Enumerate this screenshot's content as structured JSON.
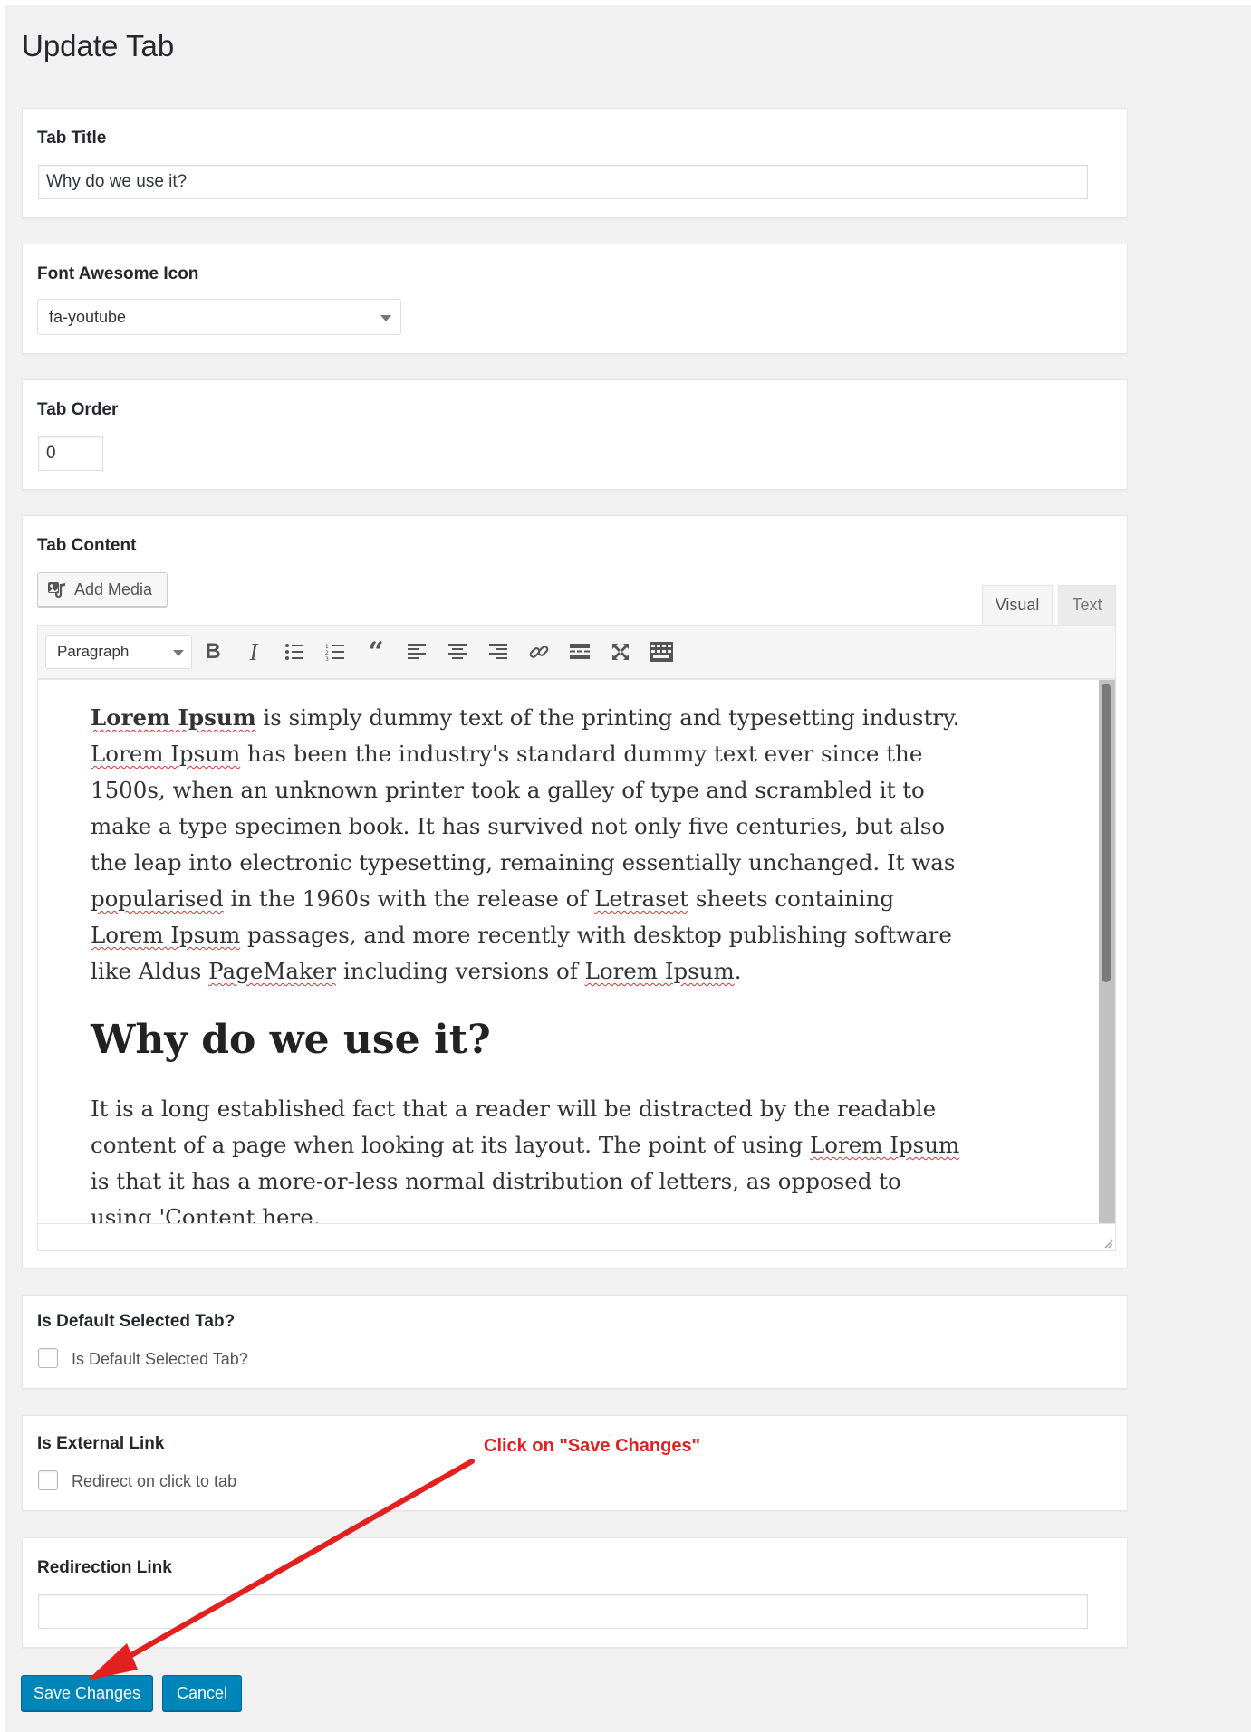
{
  "page": {
    "title": "Update Tab"
  },
  "tab_title": {
    "label": "Tab Title",
    "value": "Why do we use it?"
  },
  "icon_field": {
    "label": "Font Awesome Icon",
    "selected": "fa-youtube"
  },
  "order_field": {
    "label": "Tab Order",
    "value": "0"
  },
  "content_field": {
    "label": "Tab Content",
    "add_media": "Add Media",
    "tabs": {
      "visual": "Visual",
      "text": "Text"
    },
    "format_select": "Paragraph",
    "toolbar_icons": [
      "bold-icon",
      "italic-icon",
      "bullet-list-icon",
      "numbered-list-icon",
      "blockquote-icon",
      "align-left-icon",
      "align-center-icon",
      "align-right-icon",
      "link-icon",
      "read-more-icon",
      "fullscreen-icon",
      "toolbar-toggle-icon"
    ],
    "body": {
      "p1_b": "Lorem Ipsum",
      "p1_a": " is simply dummy text of the printing and typesetting industry. ",
      "p1_c": "Lorem Ipsum",
      "p1_d": " has been the industry's standard dummy text ever since the 1500s, when an unknown printer took a galley of type and scrambled it to make a type specimen book. It has survived not only five centuries, but also the leap into electronic typesetting, remaining essentially unchanged. It was ",
      "p1_e": "popularised",
      "p1_f": " in the 1960s with the release of ",
      "p1_g": "Letraset",
      "p1_h": " sheets containing ",
      "p1_i": "Lorem Ipsum",
      "p1_j": " passages, and more recently with desktop publishing software like Aldus ",
      "p1_k": "PageMaker",
      "p1_l": " including versions of ",
      "p1_m": "Lorem Ipsum",
      "p1_n": ".",
      "heading": "Why do we use it?",
      "p2_a": "It is a long established fact that a reader will be distracted by the readable content of a page when looking at its layout. The point of using ",
      "p2_b": "Lorem Ipsum",
      "p2_c": " is that it has a more-or-less normal distribution of letters, as opposed to using 'Content here,"
    }
  },
  "default_tab": {
    "label": "Is Default Selected Tab?",
    "checkbox_label": "Is Default Selected Tab?",
    "checked": false
  },
  "external_link": {
    "label": "Is External Link",
    "checkbox_label": "Redirect on click to tab",
    "checked": false
  },
  "redirect_link": {
    "label": "Redirection Link",
    "value": ""
  },
  "actions": {
    "save": "Save Changes",
    "cancel": "Cancel"
  },
  "annotation": {
    "text": "Click on \"Save Changes\"",
    "color": "#e32020"
  },
  "colors": {
    "primary": "#0085ba",
    "background": "#f1f1f1"
  }
}
